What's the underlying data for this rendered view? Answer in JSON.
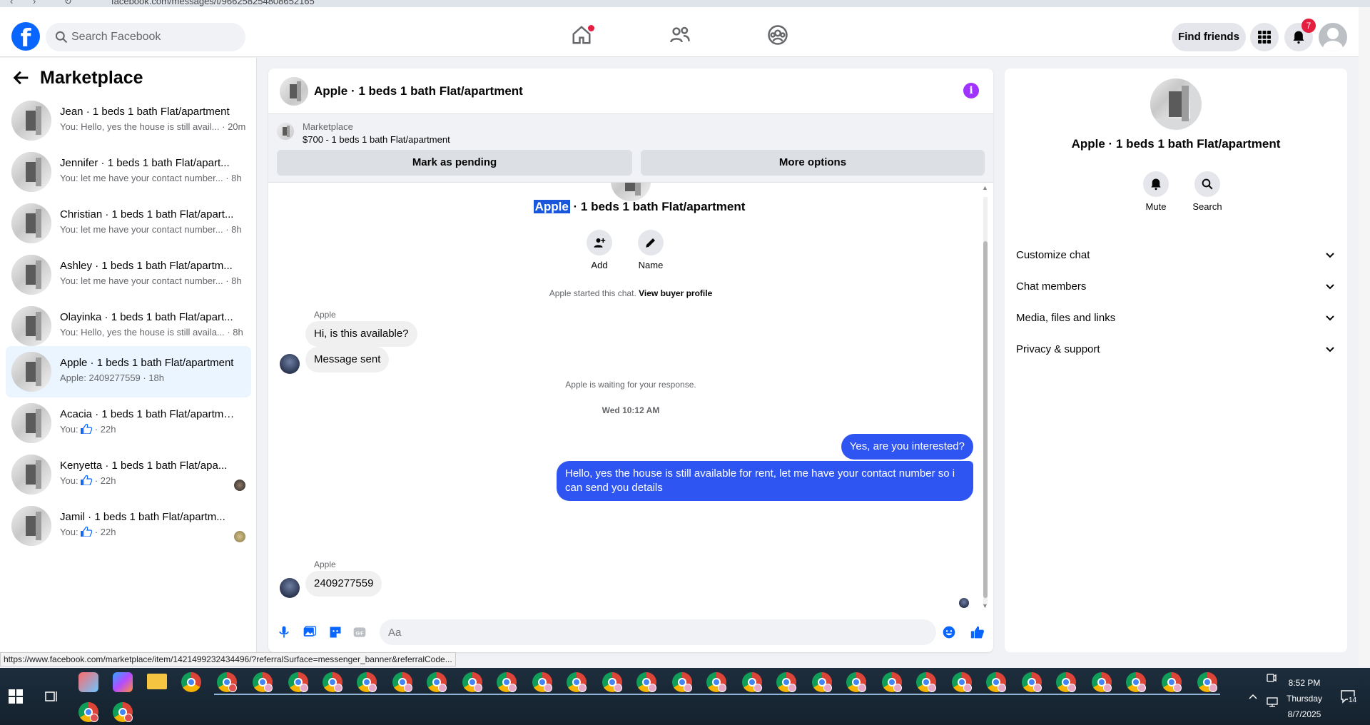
{
  "browser": {
    "url": "facebook.com/messages/t/966258254808652165"
  },
  "topbar": {
    "search_placeholder": "Search Facebook",
    "find_friends": "Find friends",
    "notifications_count": "7"
  },
  "sidebar": {
    "title": "Marketplace",
    "items": [
      {
        "name": "Jean · 1 beds 1 bath Flat/apartment",
        "preview": "You: Hello, yes the house is still avail... · 20m"
      },
      {
        "name": "Jennifer · 1 beds 1 bath Flat/apart...",
        "preview": "You: let me have your contact number... · 8h"
      },
      {
        "name": "Christian · 1 beds 1 bath Flat/apart...",
        "preview": "You: let me have your contact number... · 8h"
      },
      {
        "name": "Ashley · 1 beds 1 bath Flat/apartm...",
        "preview": "You: let me have your contact number... · 8h"
      },
      {
        "name": "Olayinka · 1 beds 1 bath Flat/apart...",
        "preview": "You: Hello, yes the house is still availa... · 8h"
      },
      {
        "name": "Apple · 1 beds 1 bath Flat/apartment",
        "preview": "Apple: 2409277559 · 18h"
      },
      {
        "name": "Acacia · 1 beds 1 bath Flat/apartme...",
        "preview_prefix": "You:",
        "preview_suffix": "· 22h"
      },
      {
        "name": "Kenyetta · 1 beds 1 bath Flat/apa...",
        "preview_prefix": "You:",
        "preview_suffix": "· 22h"
      },
      {
        "name": "Jamil · 1 beds 1 bath Flat/apartm...",
        "preview_prefix": "You:",
        "preview_suffix": "· 22h"
      }
    ]
  },
  "chat": {
    "title": "Apple · 1 beds 1 bath Flat/apartment",
    "banner": {
      "source": "Marketplace",
      "listing": "$700 - 1 beds 1 bath Flat/apartment",
      "mark_pending": "Mark as pending",
      "more_options": "More options"
    },
    "header_name_selected": "Apple",
    "header_name_rest": " · 1 beds 1 bath Flat/apartment",
    "actions": {
      "add": "Add",
      "name": "Name"
    },
    "started": "Apple started this chat.",
    "view_buyer_profile": "View buyer profile",
    "sender": "Apple",
    "msg1": "Hi, is this available?",
    "msg2": "Message sent",
    "waiting": "Apple is waiting for your response.",
    "timestamp": "Wed 10:12 AM",
    "out1": "Yes, are you interested?",
    "out2": "Hello, yes the house is still available for rent, let me have your contact number so i can send you details",
    "msg3": "2409277559",
    "compose_placeholder": "Aa"
  },
  "rpanel": {
    "title": "Apple · 1 beds 1 bath Flat/apartment",
    "mute": "Mute",
    "search": "Search",
    "sections": [
      "Customize chat",
      "Chat members",
      "Media, files and links",
      "Privacy & support"
    ]
  },
  "statusbar": "https://www.facebook.com/marketplace/item/1421499232434496/?referralSurface=messenger_banner&referralCode...",
  "taskbar": {
    "time": "8:52 PM",
    "day": "Thursday",
    "date": "8/7/2025",
    "notif_count": "14"
  },
  "colors": {
    "fb_blue": "#0866ff",
    "bubble_out": "#2e55f2",
    "notification_red": "#e41e3f"
  }
}
